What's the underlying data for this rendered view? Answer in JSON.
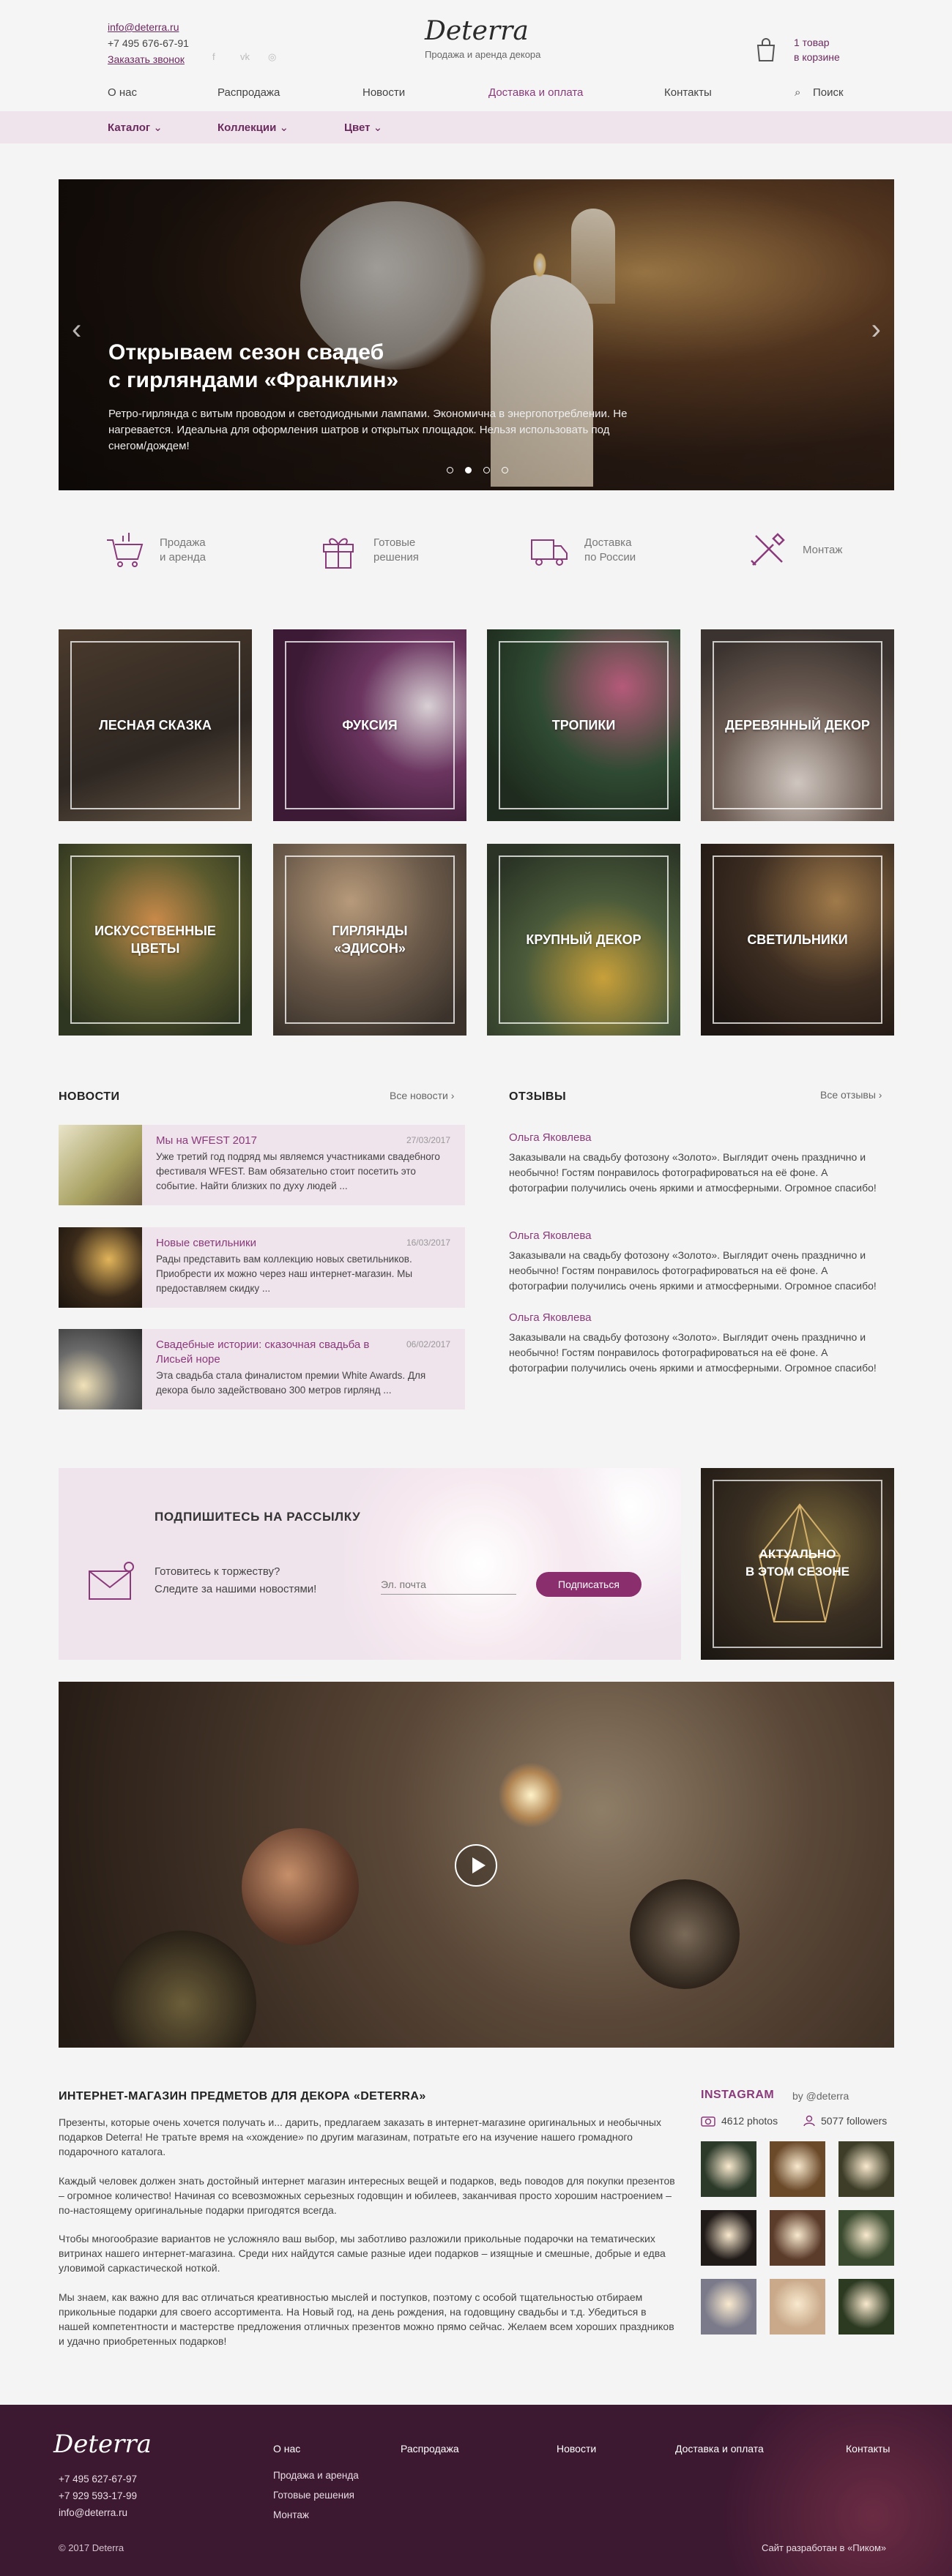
{
  "header": {
    "email": "info@deterra.ru",
    "phone": "+7 495 676-67-91",
    "callback": "Заказать звонок",
    "logo": "Deterra",
    "tagline": "Продажа и аренда декора",
    "cart": {
      "count": "1 товар",
      "label": "в корзине"
    },
    "social": [
      "facebook-icon",
      "vk-icon",
      "instagram-icon"
    ]
  },
  "nav": {
    "items": [
      "О нас",
      "Распродажа",
      "Новости",
      "Доставка и оплата",
      "Контакты"
    ],
    "search": "Поиск"
  },
  "subnav": [
    "Каталог",
    "Коллекции",
    "Цвет"
  ],
  "slider": {
    "title_line1": "Открываем сезон свадеб",
    "title_line2": "с гирляндами «Франклин»",
    "text": "Ретро-гирлянда с витым проводом и светодиодными лампами. Экономична в энергопотреблении. Не нагревается. Идеальна для оформления шатров и открытых площадок. Нельзя использовать под снегом/дождем!",
    "slides": 4,
    "active_slide": 2
  },
  "features": [
    {
      "icon": "cart-icon",
      "line1": "Продажа",
      "line2": "и аренда"
    },
    {
      "icon": "gift-icon",
      "line1": "Готовые",
      "line2": "решения"
    },
    {
      "icon": "truck-icon",
      "line1": "Доставка",
      "line2": "по России"
    },
    {
      "icon": "tools-icon",
      "line1": "Монтаж",
      "line2": ""
    }
  ],
  "collections": [
    {
      "line1": "ЛЕСНАЯ СКАЗКА",
      "line2": ""
    },
    {
      "line1": "ФУКСИЯ",
      "line2": ""
    },
    {
      "line1": "ТРОПИКИ",
      "line2": ""
    },
    {
      "line1": "ДЕРЕВЯННЫЙ ДЕКОР",
      "line2": ""
    },
    {
      "line1": "ИСКУССТВЕННЫЕ",
      "line2": "ЦВЕТЫ"
    },
    {
      "line1": "ГИРЛЯНДЫ",
      "line2": "«ЭДИСОН»"
    },
    {
      "line1": "КРУПНЫЙ ДЕКОР",
      "line2": ""
    },
    {
      "line1": "СВЕТИЛЬНИКИ",
      "line2": ""
    }
  ],
  "news": {
    "heading": "НОВОСТИ",
    "all_link": "Все новости",
    "items": [
      {
        "title": "Мы на WFEST 2017",
        "date": "27/03/2017",
        "text": "Уже третий год подряд мы являемся участниками свадебного фестиваля WFEST. Вам обязательно стоит посетить это событие. Найти близких по духу людей ..."
      },
      {
        "title": "Новые светильники",
        "date": "16/03/2017",
        "text": "Рады представить вам коллекцию новых светильников. Приобрести их можно через наш интернет-магазин. Мы предоставляем скидку ..."
      },
      {
        "title": "Свадебные истории: сказочная свадьба в Лисьей норе",
        "date": "06/02/2017",
        "text": "Эта свадьба стала финалистом премии White Awards. Для декора было задействовано 300 метров гирлянд ..."
      }
    ]
  },
  "reviews": {
    "heading": "ОТЗЫВЫ",
    "all_link": "Все отзывы",
    "items": [
      {
        "author": "Ольга Яковлева",
        "text": "Заказывали на свадьбу фотозону «Золото». Выглядит очень празднично и необычно! Гостям понравилось фотографироваться на её фоне. А фотографии получились очень яркими и атмосферными. Огромное спасибо!"
      },
      {
        "author": "Ольга Яковлева",
        "text": "Заказывали на свадьбу фотозону «Золото». Выглядит очень празднично и необычно! Гостям понравилось фотографироваться на её фоне. А фотографии получились очень яркими и атмосферными. Огромное спасибо!"
      },
      {
        "author": "Ольга Яковлева",
        "text": "Заказывали на свадьбу фотозону «Золото». Выглядит очень празднично и необычно! Гостям понравилось фотографироваться на её фоне. А фотографии получились очень яркими и атмосферными. Огромное спасибо!"
      }
    ]
  },
  "subscribe": {
    "title": "ПОДПИШИТЕСЬ НА РАССЫЛКУ",
    "line1": "Готовитесь к торжеству?",
    "line2": "Следите за нашими новостями!",
    "placeholder": "Эл. почта",
    "button": "Подписаться"
  },
  "season": {
    "line1": "АКТУАЛЬНО",
    "line2": "В ЭТОМ СЕЗОНЕ"
  },
  "about": {
    "title": "ИНТЕРНЕТ-МАГАЗИН ПРЕДМЕТОВ ДЛЯ ДЕКОРА «DETERRA»",
    "p1": "Презенты, которые очень хочется получать и... дарить, предлагаем заказать в интернет-магазине оригинальных и необычных подарков Deterra! Не тратьте время на «хождение» по другим магазинам, потратьте его на изучение нашего громадного подарочного каталога.",
    "p2": "Каждый человек должен знать достойный интернет магазин интересных вещей и подарков, ведь поводов для покупки презентов – огромное количество! Начиная со всевозможных серьезных годовщин и юбилеев, заканчивая просто хорошим настроением – по-настоящему оригинальные подарки пригодятся всегда.",
    "p3": "Чтобы многообразие вариантов не усложняло ваш выбор, мы заботливо разложили прикольные подарочки на тематических витринах нашего интернет-магазина. Среди них найдутся самые разные идеи подарков – изящные и смешные, добрые и едва уловимой саркастической ноткой.",
    "p4": "Мы знаем, как важно для вас отличаться креативностью мыслей и поступков, поэтому с особой тщательностью отбираем прикольные подарки для своего ассортимента. На Новый год, на день рождения, на годовщину свадьбы и т.д. Убедиться в нашей компетентности и мастерстве предложения отличных презентов можно прямо сейчас. Желаем всем хороших праздников и удачно приобретенных подарков!"
  },
  "instagram": {
    "title": "INSTAGRAM",
    "by": "by @deterra",
    "photos": "4612 photos",
    "followers": "5077 followers",
    "tiles": [
      "#2c3a2a",
      "#6b4a2a",
      "#3e3e28",
      "#201a18",
      "#5b3b2a",
      "#3a4a2e",
      "#7a7a8a",
      "#c9a98a",
      "#2d3a22"
    ]
  },
  "footer": {
    "logo": "Deterra",
    "phone1": "+7 495 627-67-97",
    "phone2": "+7 929 593-17-99",
    "email": "info@deterra.ru",
    "copyright": "© 2017 Deterra",
    "nav": [
      "О нас",
      "Распродажа",
      "Новости",
      "Доставка и оплата",
      "Контакты"
    ],
    "sub": [
      "Продажа и аренда",
      "Готовые решения",
      "Монтаж"
    ],
    "developer": "Сайт разработан в «Пиком»"
  },
  "colors": {
    "accent": "#8a2e6e",
    "accent_text": "#8a3a7b",
    "panel": "#efe3ec",
    "footer": "#3d1831"
  }
}
